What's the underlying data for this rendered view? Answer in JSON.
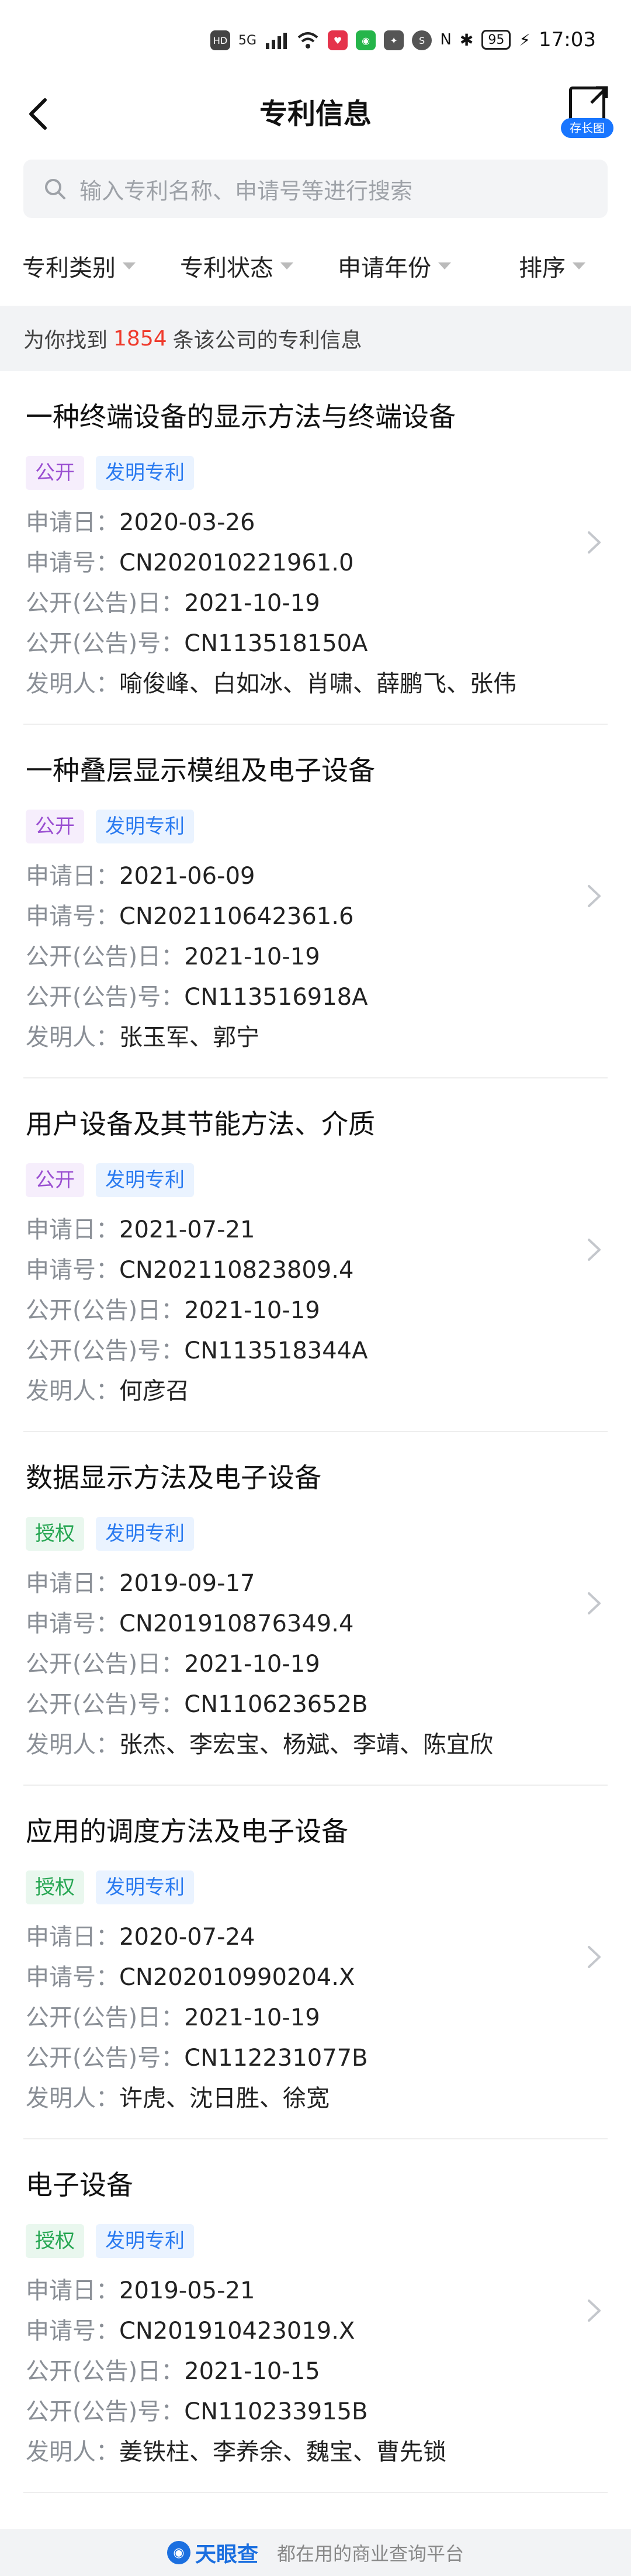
{
  "status_bar": {
    "time": "17:03",
    "battery": "95",
    "network": "5G"
  },
  "nav": {
    "title": "专利信息",
    "long_image_label": "存长图"
  },
  "search": {
    "placeholder": "输入专利名称、申请号等进行搜索"
  },
  "filters": [
    "专利类别",
    "专利状态",
    "申请年份",
    "排序"
  ],
  "banner": {
    "prefix": "为你找到",
    "count": "1854",
    "suffix": "条该公司的专利信息"
  },
  "field_labels": {
    "apply_date": "申请日：",
    "apply_no": "申请号：",
    "pub_date": "公开(公告)日：",
    "pub_no": "公开(公告)号：",
    "inventors": "发明人："
  },
  "patents": [
    {
      "title": "一种终端设备的显示方法与终端设备",
      "status": "公开",
      "status_kind": "pub",
      "type": "发明专利",
      "apply_date": "2020-03-26",
      "apply_no": "CN202010221961.0",
      "pub_date": "2021-10-19",
      "pub_no": "CN113518150A",
      "inventors": "喻俊峰、白如冰、肖啸、薛鹏飞、张伟"
    },
    {
      "title": "一种叠层显示模组及电子设备",
      "status": "公开",
      "status_kind": "pub",
      "type": "发明专利",
      "apply_date": "2021-06-09",
      "apply_no": "CN202110642361.6",
      "pub_date": "2021-10-19",
      "pub_no": "CN113516918A",
      "inventors": "张玉军、郭宁"
    },
    {
      "title": "用户设备及其节能方法、介质",
      "status": "公开",
      "status_kind": "pub",
      "type": "发明专利",
      "apply_date": "2021-07-21",
      "apply_no": "CN202110823809.4",
      "pub_date": "2021-10-19",
      "pub_no": "CN113518344A",
      "inventors": "何彦召"
    },
    {
      "title": "数据显示方法及电子设备",
      "status": "授权",
      "status_kind": "grant",
      "type": "发明专利",
      "apply_date": "2019-09-17",
      "apply_no": "CN201910876349.4",
      "pub_date": "2021-10-19",
      "pub_no": "CN110623652B",
      "inventors": "张杰、李宏宝、杨斌、李靖、陈宜欣"
    },
    {
      "title": "应用的调度方法及电子设备",
      "status": "授权",
      "status_kind": "grant",
      "type": "发明专利",
      "apply_date": "2020-07-24",
      "apply_no": "CN202010990204.X",
      "pub_date": "2021-10-19",
      "pub_no": "CN112231077B",
      "inventors": "许虎、沈日胜、徐宽"
    },
    {
      "title": "电子设备",
      "status": "授权",
      "status_kind": "grant",
      "type": "发明专利",
      "apply_date": "2019-05-21",
      "apply_no": "CN201910423019.X",
      "pub_date": "2021-10-15",
      "pub_no": "CN110233915B",
      "inventors": "姜铁柱、李养余、魏宝、曹先锁"
    }
  ],
  "footer": {
    "brand": "天眼查",
    "slogan": "都在用的商业查询平台"
  },
  "colors": {
    "accent_blue": "#1976ff",
    "count_red": "#ef3a2c",
    "tag_pub": "#9a4fd1",
    "tag_grant": "#26a652",
    "tag_type": "#2b7bf0"
  }
}
